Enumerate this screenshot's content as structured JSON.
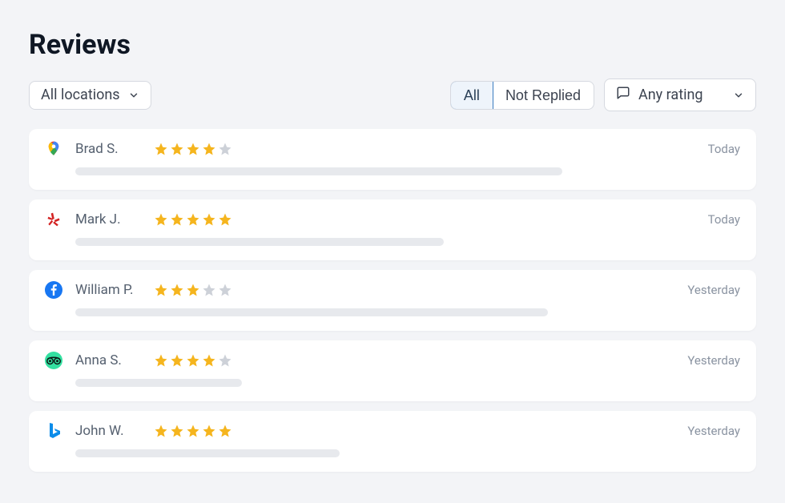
{
  "title": "Reviews",
  "location_filter": {
    "label": "All locations"
  },
  "tabs": {
    "all": "All",
    "not_replied": "Not Replied",
    "active": "all"
  },
  "rating_filter": {
    "label": "Any rating"
  },
  "colors": {
    "star_filled": "#f5b51e",
    "star_empty": "#cdd1d8"
  },
  "reviews": [
    {
      "source": "google",
      "name": "Brad S.",
      "rating": 4,
      "time": "Today",
      "bar_pct": 70
    },
    {
      "source": "yelp",
      "name": "Mark J.",
      "rating": 5,
      "time": "Today",
      "bar_pct": 53
    },
    {
      "source": "facebook",
      "name": "William P.",
      "rating": 3,
      "time": "Yesterday",
      "bar_pct": 68
    },
    {
      "source": "tripadvisor",
      "name": "Anna S.",
      "rating": 4,
      "time": "Yesterday",
      "bar_pct": 24
    },
    {
      "source": "bing",
      "name": "John W.",
      "rating": 5,
      "time": "Yesterday",
      "bar_pct": 38
    }
  ]
}
